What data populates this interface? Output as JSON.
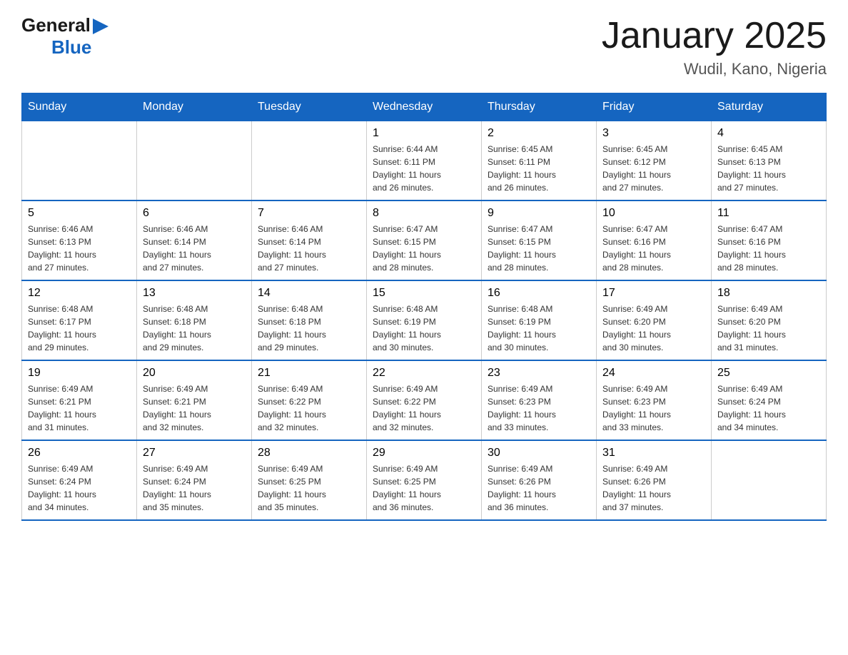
{
  "header": {
    "logo_general": "General",
    "logo_blue": "Blue",
    "month_title": "January 2025",
    "location": "Wudil, Kano, Nigeria"
  },
  "days_of_week": [
    "Sunday",
    "Monday",
    "Tuesday",
    "Wednesday",
    "Thursday",
    "Friday",
    "Saturday"
  ],
  "weeks": [
    [
      {
        "day": "",
        "info": ""
      },
      {
        "day": "",
        "info": ""
      },
      {
        "day": "",
        "info": ""
      },
      {
        "day": "1",
        "info": "Sunrise: 6:44 AM\nSunset: 6:11 PM\nDaylight: 11 hours\nand 26 minutes."
      },
      {
        "day": "2",
        "info": "Sunrise: 6:45 AM\nSunset: 6:11 PM\nDaylight: 11 hours\nand 26 minutes."
      },
      {
        "day": "3",
        "info": "Sunrise: 6:45 AM\nSunset: 6:12 PM\nDaylight: 11 hours\nand 27 minutes."
      },
      {
        "day": "4",
        "info": "Sunrise: 6:45 AM\nSunset: 6:13 PM\nDaylight: 11 hours\nand 27 minutes."
      }
    ],
    [
      {
        "day": "5",
        "info": "Sunrise: 6:46 AM\nSunset: 6:13 PM\nDaylight: 11 hours\nand 27 minutes."
      },
      {
        "day": "6",
        "info": "Sunrise: 6:46 AM\nSunset: 6:14 PM\nDaylight: 11 hours\nand 27 minutes."
      },
      {
        "day": "7",
        "info": "Sunrise: 6:46 AM\nSunset: 6:14 PM\nDaylight: 11 hours\nand 27 minutes."
      },
      {
        "day": "8",
        "info": "Sunrise: 6:47 AM\nSunset: 6:15 PM\nDaylight: 11 hours\nand 28 minutes."
      },
      {
        "day": "9",
        "info": "Sunrise: 6:47 AM\nSunset: 6:15 PM\nDaylight: 11 hours\nand 28 minutes."
      },
      {
        "day": "10",
        "info": "Sunrise: 6:47 AM\nSunset: 6:16 PM\nDaylight: 11 hours\nand 28 minutes."
      },
      {
        "day": "11",
        "info": "Sunrise: 6:47 AM\nSunset: 6:16 PM\nDaylight: 11 hours\nand 28 minutes."
      }
    ],
    [
      {
        "day": "12",
        "info": "Sunrise: 6:48 AM\nSunset: 6:17 PM\nDaylight: 11 hours\nand 29 minutes."
      },
      {
        "day": "13",
        "info": "Sunrise: 6:48 AM\nSunset: 6:18 PM\nDaylight: 11 hours\nand 29 minutes."
      },
      {
        "day": "14",
        "info": "Sunrise: 6:48 AM\nSunset: 6:18 PM\nDaylight: 11 hours\nand 29 minutes."
      },
      {
        "day": "15",
        "info": "Sunrise: 6:48 AM\nSunset: 6:19 PM\nDaylight: 11 hours\nand 30 minutes."
      },
      {
        "day": "16",
        "info": "Sunrise: 6:48 AM\nSunset: 6:19 PM\nDaylight: 11 hours\nand 30 minutes."
      },
      {
        "day": "17",
        "info": "Sunrise: 6:49 AM\nSunset: 6:20 PM\nDaylight: 11 hours\nand 30 minutes."
      },
      {
        "day": "18",
        "info": "Sunrise: 6:49 AM\nSunset: 6:20 PM\nDaylight: 11 hours\nand 31 minutes."
      }
    ],
    [
      {
        "day": "19",
        "info": "Sunrise: 6:49 AM\nSunset: 6:21 PM\nDaylight: 11 hours\nand 31 minutes."
      },
      {
        "day": "20",
        "info": "Sunrise: 6:49 AM\nSunset: 6:21 PM\nDaylight: 11 hours\nand 32 minutes."
      },
      {
        "day": "21",
        "info": "Sunrise: 6:49 AM\nSunset: 6:22 PM\nDaylight: 11 hours\nand 32 minutes."
      },
      {
        "day": "22",
        "info": "Sunrise: 6:49 AM\nSunset: 6:22 PM\nDaylight: 11 hours\nand 32 minutes."
      },
      {
        "day": "23",
        "info": "Sunrise: 6:49 AM\nSunset: 6:23 PM\nDaylight: 11 hours\nand 33 minutes."
      },
      {
        "day": "24",
        "info": "Sunrise: 6:49 AM\nSunset: 6:23 PM\nDaylight: 11 hours\nand 33 minutes."
      },
      {
        "day": "25",
        "info": "Sunrise: 6:49 AM\nSunset: 6:24 PM\nDaylight: 11 hours\nand 34 minutes."
      }
    ],
    [
      {
        "day": "26",
        "info": "Sunrise: 6:49 AM\nSunset: 6:24 PM\nDaylight: 11 hours\nand 34 minutes."
      },
      {
        "day": "27",
        "info": "Sunrise: 6:49 AM\nSunset: 6:24 PM\nDaylight: 11 hours\nand 35 minutes."
      },
      {
        "day": "28",
        "info": "Sunrise: 6:49 AM\nSunset: 6:25 PM\nDaylight: 11 hours\nand 35 minutes."
      },
      {
        "day": "29",
        "info": "Sunrise: 6:49 AM\nSunset: 6:25 PM\nDaylight: 11 hours\nand 36 minutes."
      },
      {
        "day": "30",
        "info": "Sunrise: 6:49 AM\nSunset: 6:26 PM\nDaylight: 11 hours\nand 36 minutes."
      },
      {
        "day": "31",
        "info": "Sunrise: 6:49 AM\nSunset: 6:26 PM\nDaylight: 11 hours\nand 37 minutes."
      },
      {
        "day": "",
        "info": ""
      }
    ]
  ]
}
